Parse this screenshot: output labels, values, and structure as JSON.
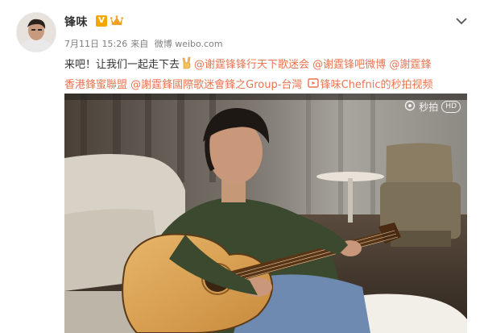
{
  "post": {
    "username": "锋味",
    "verified_badge": "V",
    "date": "7月11日 15:26",
    "source_prefix": "来自",
    "source": "微博 weibo.com",
    "text_lead": "来吧！让我们一起走下去",
    "mentions_line1": [
      "@谢霆锋锋行天下歌迷会",
      "@谢霆锋吧微博"
    ],
    "mentions_line1_tail": "@謝霆鋒",
    "mentions_line2_head": "香港鋒蜜聯盟",
    "mentions_line2": [
      "@謝霆鋒國際歌迷會鋒之Group-台灣"
    ],
    "video_link": "锋味Chefnic的秒拍视频",
    "video_watermark": "秒拍",
    "video_quality": "HD",
    "accent_color": "#eb7350",
    "icons": [
      "avatar",
      "verified-v-icon",
      "crown-badge-icon",
      "chevron-down-icon",
      "rock-hand-emoji-icon",
      "video-link-icon",
      "camera-icon"
    ]
  }
}
